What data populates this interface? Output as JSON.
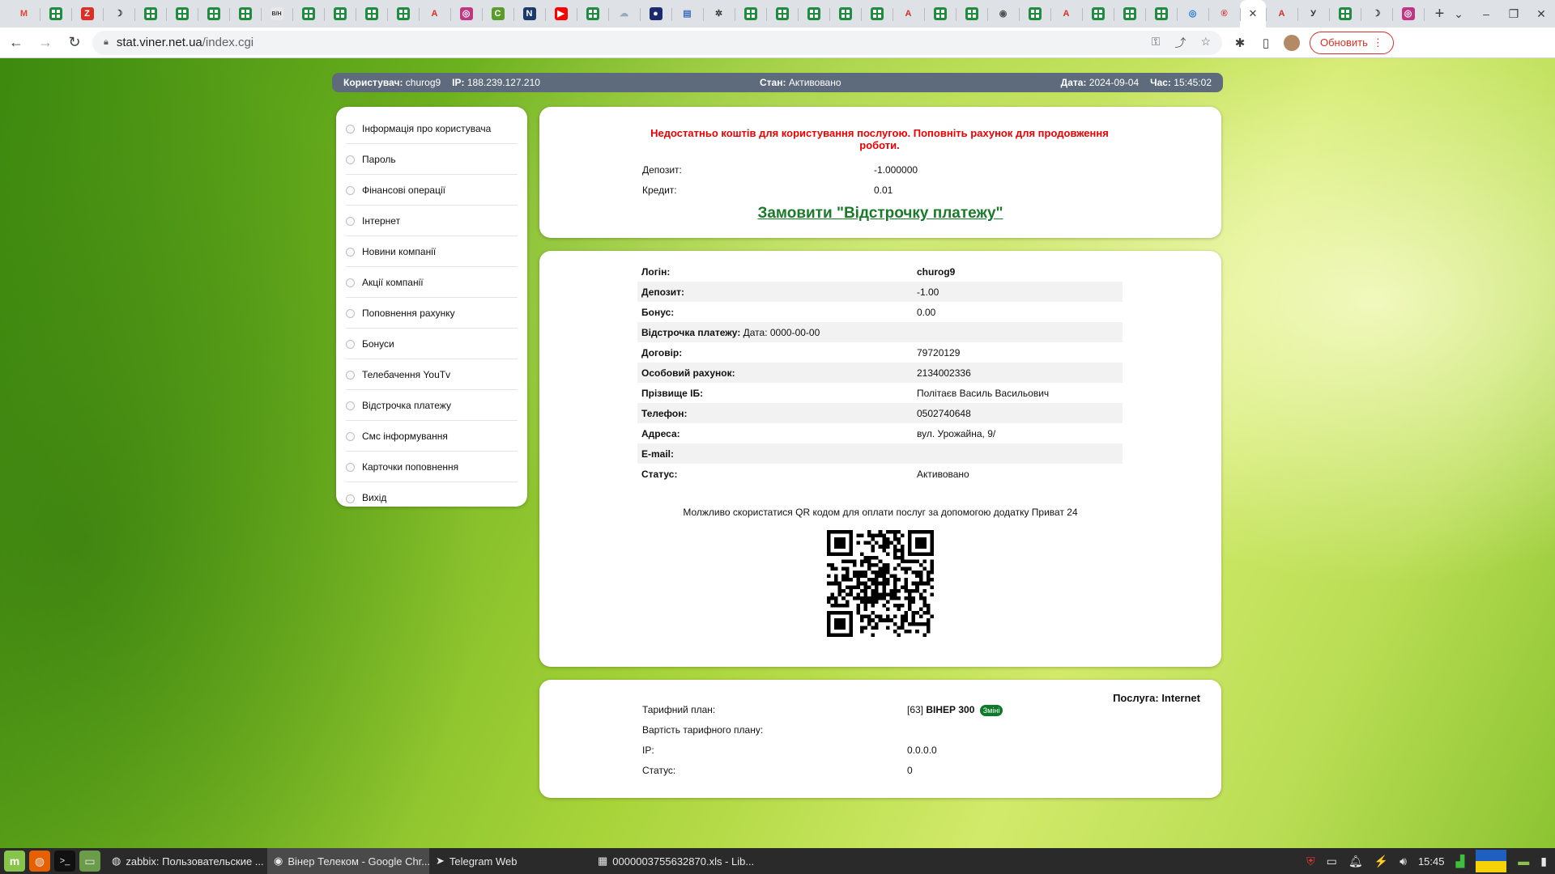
{
  "browser": {
    "tabs": [
      {
        "icon": "gmail-icon",
        "glyph": "M",
        "color": "#ea4335",
        "bg": "transparent"
      },
      {
        "icon": "sheets-icon",
        "sheet": true
      },
      {
        "icon": "zoho-icon",
        "glyph": "Z",
        "color": "#fff",
        "bg": "#d93025"
      },
      {
        "icon": "moon-icon",
        "glyph": "☽",
        "color": "#333",
        "bg": "transparent"
      },
      {
        "icon": "sheets-icon",
        "sheet": true
      },
      {
        "icon": "sheets-icon",
        "sheet": true
      },
      {
        "icon": "sheets-icon",
        "sheet": true
      },
      {
        "icon": "sheets-icon",
        "sheet": true
      },
      {
        "icon": "bh-icon",
        "glyph": "B/H",
        "color": "#333",
        "bg": "#e8e8e8"
      },
      {
        "icon": "sheets-icon",
        "sheet": true
      },
      {
        "icon": "sheets-icon",
        "sheet": true
      },
      {
        "icon": "sheets-icon",
        "sheet": true
      },
      {
        "icon": "sheets-icon",
        "sheet": true
      },
      {
        "icon": "acrobat-icon",
        "glyph": "A",
        "color": "#d93025",
        "bg": "transparent"
      },
      {
        "icon": "instagram-icon",
        "glyph": "◎",
        "color": "#fff",
        "bg": "#c13584"
      },
      {
        "icon": "c-icon",
        "glyph": "C",
        "color": "#fff",
        "bg": "#5b9b2a"
      },
      {
        "icon": "n-icon",
        "glyph": "N",
        "color": "#fff",
        "bg": "#1b3a6b"
      },
      {
        "icon": "youtube-icon",
        "glyph": "▶",
        "color": "#fff",
        "bg": "#ff0000"
      },
      {
        "icon": "sheets-icon",
        "sheet": true
      },
      {
        "icon": "cloud-icon",
        "glyph": "☁",
        "color": "#9ab",
        "bg": "transparent"
      },
      {
        "icon": "shield-icon",
        "glyph": "●",
        "color": "#fff",
        "bg": "#1a2a6c"
      },
      {
        "icon": "doc-icon",
        "glyph": "▤",
        "color": "#3c6ebf",
        "bg": "transparent"
      },
      {
        "icon": "openai-icon",
        "glyph": "✲",
        "color": "#333",
        "bg": "transparent"
      },
      {
        "icon": "sheets-icon",
        "sheet": true
      },
      {
        "icon": "sheets-icon",
        "sheet": true
      },
      {
        "icon": "sheets-icon",
        "sheet": true
      },
      {
        "icon": "sheets-icon",
        "sheet": true
      },
      {
        "icon": "sheets-icon",
        "sheet": true
      },
      {
        "icon": "acrobat-icon",
        "glyph": "A",
        "color": "#d93025",
        "bg": "transparent"
      },
      {
        "icon": "sheets-icon",
        "sheet": true
      },
      {
        "icon": "sheets-icon",
        "sheet": true
      },
      {
        "icon": "globe-icon",
        "glyph": "◉",
        "color": "#555",
        "bg": "transparent"
      },
      {
        "icon": "sheets-icon",
        "sheet": true
      },
      {
        "icon": "acrobat-icon",
        "glyph": "A",
        "color": "#d93025",
        "bg": "transparent"
      },
      {
        "icon": "sheets-icon",
        "sheet": true
      },
      {
        "icon": "sheets-icon",
        "sheet": true
      },
      {
        "icon": "sheets-icon",
        "sheet": true
      },
      {
        "icon": "target-icon",
        "glyph": "◎",
        "color": "#1a73e8",
        "bg": "transparent"
      },
      {
        "icon": "r-icon",
        "glyph": "®",
        "color": "#d93025",
        "bg": "transparent"
      }
    ],
    "active_tab_close": "✕",
    "trailing_tabs": [
      {
        "icon": "acrobat-icon",
        "glyph": "A",
        "color": "#d93025",
        "bg": "transparent"
      },
      {
        "icon": "y-icon",
        "glyph": "У",
        "color": "#333",
        "bg": "transparent"
      },
      {
        "icon": "sheets-icon",
        "sheet": true
      },
      {
        "icon": "moon-icon",
        "glyph": "☽",
        "color": "#333",
        "bg": "transparent"
      },
      {
        "icon": "instagram-icon",
        "glyph": "◎",
        "color": "#fff",
        "bg": "#c13584"
      }
    ],
    "new_tab": "+",
    "url_host": "stat.viner.net.ua",
    "url_path": "/index.cgi",
    "update_label": "Обновить"
  },
  "infobar": {
    "user_label": "Користувач:",
    "user_value": "churog9",
    "ip_label": "IP:",
    "ip_value": "188.239.127.210",
    "state_label": "Стан:",
    "state_value": "Активовано",
    "date_label": "Дата:",
    "date_value": "2024-09-04",
    "time_label": "Час:",
    "time_value": "15:45:02"
  },
  "sidebar": {
    "items": [
      "Інформація про користувача",
      "Пароль",
      "Фінансові операції",
      "Інтернет",
      "Новини компанії",
      "Акції компанії",
      "Поповнення рахунку",
      "Бонуси",
      "Телебачення YouTv",
      "Відстрочка платежу",
      "Смс інформування",
      "Карточки поповнення",
      "Вихід"
    ]
  },
  "alert": {
    "text": "Недостатньо коштів для користування послугою. Поповніть рахунок для продовження роботи.",
    "deposit_label": "Депозит:",
    "deposit_value": "-1.000000",
    "credit_label": "Кредит:",
    "credit_value": "0.01",
    "order_link": "Замовити \"Відстрочку платежу\""
  },
  "user_info": {
    "rows": [
      {
        "k": "Логін:",
        "v": "churog9",
        "bold_v": true
      },
      {
        "k": "Депозит:",
        "v": "-1.00"
      },
      {
        "k": "Бонус:",
        "v": "0.00"
      },
      {
        "k": "Відстрочка платежу:",
        "extra": " Дата: 0000-00-00",
        "v": ""
      },
      {
        "k": "Договір:",
        "v": "79720129"
      },
      {
        "k": "Особовий рахунок:",
        "v": "2134002336"
      },
      {
        "k": "Прізвище ІБ:",
        "v": "Політаєв Василь Васильович"
      },
      {
        "k": "Телефон:",
        "v": "0502740648"
      },
      {
        "k": "Адреса:",
        "v": "вул. Урожайна, 9/"
      },
      {
        "k": "E-mail:",
        "v": ""
      },
      {
        "k": "Статус:",
        "v": "Активовано"
      }
    ],
    "qr_note": "Молжливо скористатися QR кодом для оплати послуг за допомогою додатку Приват 24"
  },
  "service": {
    "title": "Послуга: Internet",
    "tariff_label": "Тарифний план:",
    "tariff_id": "[63]",
    "tariff_name": "ВІНЕР 300",
    "change_label": "Змінi",
    "cost_label": "Вартість тарифного плану:",
    "cost_value": "",
    "ip_label": "IP:",
    "ip_value": "0.0.0.0",
    "status_label": "Статус:",
    "status_value": "0"
  },
  "taskbar": {
    "apps": [
      {
        "label": "zabbix: Пользовательские ...",
        "icon": "firefox-icon",
        "glyph": "◍",
        "active": false
      },
      {
        "label": "Вінер Телеком - Google Chr...",
        "icon": "chrome-icon",
        "glyph": "◉",
        "active": true
      },
      {
        "label": "Telegram Web",
        "icon": "telegram-icon",
        "glyph": "➤",
        "active": false
      },
      {
        "label": "0000003755632870.xls - Lib...",
        "icon": "calc-icon",
        "glyph": "▦",
        "active": false
      }
    ],
    "clock": "15:45"
  }
}
